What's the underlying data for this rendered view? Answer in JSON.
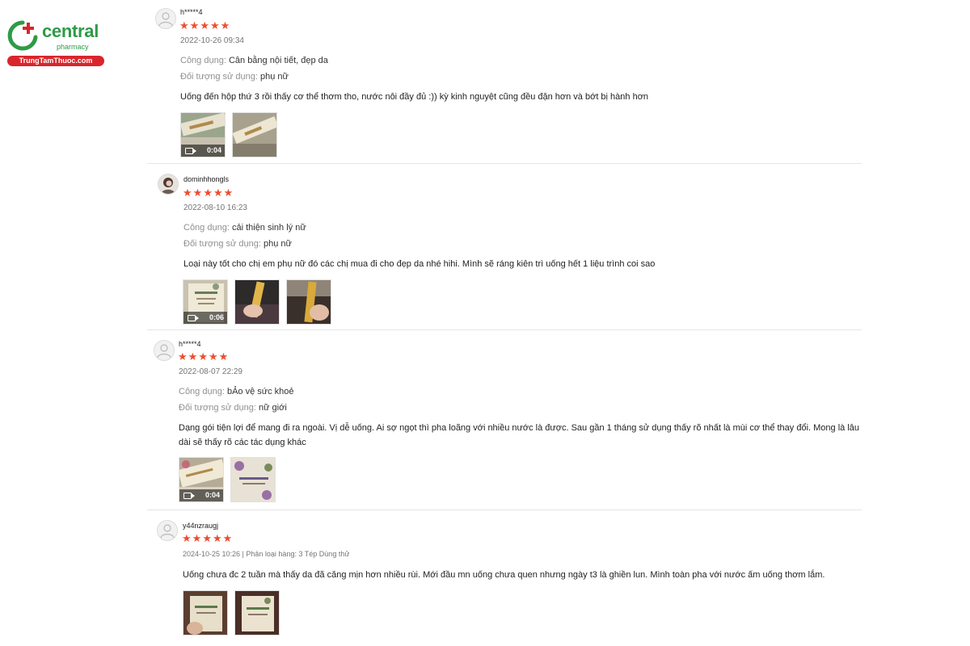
{
  "logo": {
    "name": "central",
    "sub": "pharmacy",
    "site": "TrungTamThuoc.com"
  },
  "colors": {
    "star": "#ee4d2d",
    "brand_green": "#2e9b46",
    "brand_red": "#d8262c"
  },
  "labels": {
    "cong_dung": "Công dụng:",
    "doi_tuong": "Đối tượng sử dụng:"
  },
  "reviews": [
    {
      "username": "h*****4",
      "rating": 5,
      "date": "2022-10-26 09:34",
      "cong_dung": "Cân bằng nội tiết, đẹp da",
      "doi_tuong": "phụ nữ",
      "comment": "Uống đến hộp thứ 3 rồi thấy cơ thể thơm tho, nước nôi đầy đủ :)) kỳ kinh nguyệt cũng đều đặn hơn và bớt bị hành hơn",
      "media": [
        {
          "type": "video",
          "duration": "0:04"
        },
        {
          "type": "image"
        }
      ]
    },
    {
      "username": "dominhhongls",
      "rating": 5,
      "date": "2022-08-10 16:23",
      "cong_dung": "cải thiện sinh lý nữ",
      "doi_tuong": "phụ nữ",
      "comment": "Loại này tốt cho chị em phụ nữ đó các chị mua đi cho đẹp da nhé hihi. Mình sẽ ráng kiên trì uống hết 1 liệu trình coi sao",
      "media": [
        {
          "type": "video",
          "duration": "0:06"
        },
        {
          "type": "image"
        },
        {
          "type": "image"
        }
      ]
    },
    {
      "username": "h*****4",
      "rating": 5,
      "date": "2022-08-07 22:29",
      "cong_dung": "bẢo vệ sức khoẻ",
      "doi_tuong": "nữ giới",
      "comment": "Dạng gói tiện lợi để mang đi ra ngoài. Vị dễ uống. Ai sợ ngọt thì pha loãng với nhiều nước là được. Sau gần 1 tháng sử dụng thấy rõ nhất là mùi cơ thể thay đổi. Mong là lâu dài sẽ thấy rõ các tác dụng khác",
      "media": [
        {
          "type": "video",
          "duration": "0:04"
        },
        {
          "type": "image"
        }
      ]
    },
    {
      "username": "y44nzraugj",
      "rating": 5,
      "date": "2024-10-25 10:26 | Phân loại hàng: 3 Tép Dùng thử",
      "comment": "Uống chưa đc 2 tuần mà thấy da đã căng mịn hơn nhiều rùi. Mới đầu mn uống chưa quen nhưng ngày t3 là ghiền lun. Mình toàn pha với nước ấm uống thơm lắm.",
      "media": [
        {
          "type": "image"
        },
        {
          "type": "image"
        }
      ]
    }
  ]
}
